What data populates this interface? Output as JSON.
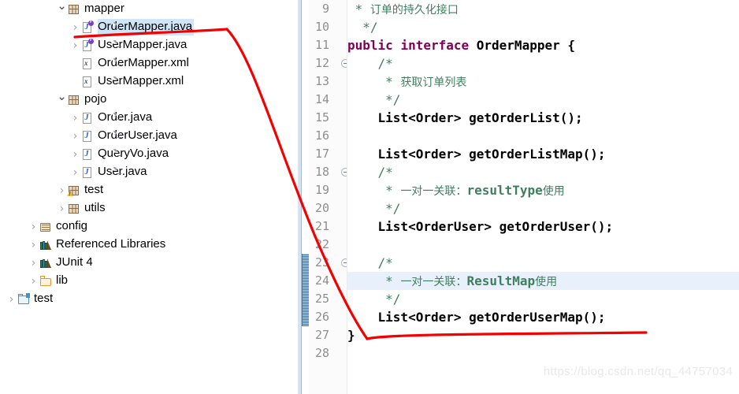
{
  "explorer": {
    "name": "package-explorer",
    "items": [
      {
        "label": "mapper",
        "indent": 72,
        "arrow": "open",
        "icon": "package-icon"
      },
      {
        "label": "OrderMapper.java",
        "indent": 89,
        "arrow": "closed",
        "icon": "java-interface-icon",
        "selected": true
      },
      {
        "label": "UserMapper.java",
        "indent": 89,
        "arrow": "closed",
        "icon": "java-interface-icon"
      },
      {
        "label": "OrderMapper.xml",
        "indent": 89,
        "arrow": "none",
        "icon": "xml-file-icon"
      },
      {
        "label": "UserMapper.xml",
        "indent": 89,
        "arrow": "none",
        "icon": "xml-file-icon"
      },
      {
        "label": "pojo",
        "indent": 72,
        "arrow": "open",
        "icon": "package-icon"
      },
      {
        "label": "Order.java",
        "indent": 89,
        "arrow": "closed",
        "icon": "java-class-icon"
      },
      {
        "label": "OrderUser.java",
        "indent": 89,
        "arrow": "closed",
        "icon": "java-class-icon"
      },
      {
        "label": "QueryVo.java",
        "indent": 89,
        "arrow": "closed",
        "icon": "java-class-icon"
      },
      {
        "label": "User.java",
        "indent": 89,
        "arrow": "closed",
        "icon": "java-class-icon"
      },
      {
        "label": "test",
        "indent": 72,
        "arrow": "closed",
        "icon": "package-warning-icon"
      },
      {
        "label": "utils",
        "indent": 72,
        "arrow": "closed",
        "icon": "package-icon"
      },
      {
        "label": "config",
        "indent": 36,
        "arrow": "closed",
        "icon": "source-folder-icon"
      },
      {
        "label": "Referenced Libraries",
        "indent": 36,
        "arrow": "closed",
        "icon": "library-icon"
      },
      {
        "label": "JUnit 4",
        "indent": 36,
        "arrow": "closed",
        "icon": "library-icon"
      },
      {
        "label": "lib",
        "indent": 36,
        "arrow": "closed",
        "icon": "folder-icon"
      },
      {
        "label": "test",
        "indent": 8,
        "arrow": "closed",
        "icon": "project-folder-icon"
      }
    ]
  },
  "editor": {
    "name": "java-editor",
    "first_line": 9,
    "highlighted_line": 24,
    "change_bar_lines": [
      23,
      26
    ],
    "fold_lines": [
      12,
      18,
      23
    ],
    "lines": [
      {
        "n": 9,
        "segments": [
          {
            "t": " * ",
            "c": "cm"
          },
          {
            "t": "订单的持久化接口",
            "c": "cn cm"
          }
        ]
      },
      {
        "n": 10,
        "segments": [
          {
            "t": "  */",
            "c": "cm"
          }
        ]
      },
      {
        "n": 11,
        "segments": [
          {
            "t": "public ",
            "c": "kw"
          },
          {
            "t": "interface ",
            "c": "kw"
          },
          {
            "t": "OrderMapper {",
            "c": "pl"
          }
        ]
      },
      {
        "n": 12,
        "segments": [
          {
            "t": "    /*",
            "c": "cm"
          }
        ]
      },
      {
        "n": 13,
        "segments": [
          {
            "t": "     * ",
            "c": "cm"
          },
          {
            "t": "获取订单列表",
            "c": "cn cm"
          }
        ]
      },
      {
        "n": 14,
        "segments": [
          {
            "t": "     */",
            "c": "cm"
          }
        ]
      },
      {
        "n": 15,
        "segments": [
          {
            "t": "    List<Order> getOrderList();",
            "c": "pl"
          }
        ]
      },
      {
        "n": 16,
        "segments": [
          {
            "t": "",
            "c": "pl"
          }
        ]
      },
      {
        "n": 17,
        "segments": [
          {
            "t": "    List<Order> getOrderListMap();",
            "c": "pl"
          }
        ]
      },
      {
        "n": 18,
        "segments": [
          {
            "t": "    /*",
            "c": "cm"
          }
        ]
      },
      {
        "n": 19,
        "segments": [
          {
            "t": "     * ",
            "c": "cm"
          },
          {
            "t": "一对一关联：",
            "c": "cn cm"
          },
          {
            "t": "resultType",
            "c": "cmk"
          },
          {
            "t": "使用",
            "c": "cn cm"
          }
        ]
      },
      {
        "n": 20,
        "segments": [
          {
            "t": "     */",
            "c": "cm"
          }
        ]
      },
      {
        "n": 21,
        "segments": [
          {
            "t": "    List<OrderUser> getOrderUser();",
            "c": "pl"
          }
        ]
      },
      {
        "n": 22,
        "segments": [
          {
            "t": "",
            "c": "pl"
          }
        ]
      },
      {
        "n": 23,
        "segments": [
          {
            "t": "    /*",
            "c": "cm"
          }
        ]
      },
      {
        "n": 24,
        "segments": [
          {
            "t": "     * ",
            "c": "cm"
          },
          {
            "t": "一对一关联：",
            "c": "cn cm"
          },
          {
            "t": "ResultMap",
            "c": "cmk"
          },
          {
            "t": "使用",
            "c": "cn cm"
          }
        ]
      },
      {
        "n": 25,
        "segments": [
          {
            "t": "     */",
            "c": "cm"
          }
        ]
      },
      {
        "n": 26,
        "segments": [
          {
            "t": "    List<Order> getOrderUserMap();",
            "c": "pl"
          }
        ]
      },
      {
        "n": 27,
        "segments": [
          {
            "t": "}",
            "c": "pl"
          }
        ]
      },
      {
        "n": 28,
        "segments": [
          {
            "t": "",
            "c": "pl"
          }
        ]
      }
    ]
  },
  "watermark": {
    "text": "https://blog.csdn.net/qq_44757034"
  },
  "annotation": {
    "color": "#f50000",
    "stroke_width": 3.2,
    "paths": [
      "M 95,47 C 150,43 230,41 288,37",
      "M 288,37 C 320,70 352,185 400,300 C 430,370 452,410 466,430",
      "M 466,430 C 490,424 620,424 820,422"
    ]
  },
  "colors": {
    "selection_blue": "#cfe6f8",
    "highlight_line": "#e7f0fb",
    "keyword": "#7f0055",
    "comment": "#3f7f5f",
    "line_number": "#8f8f8f",
    "annotation_red": "#f50000"
  }
}
